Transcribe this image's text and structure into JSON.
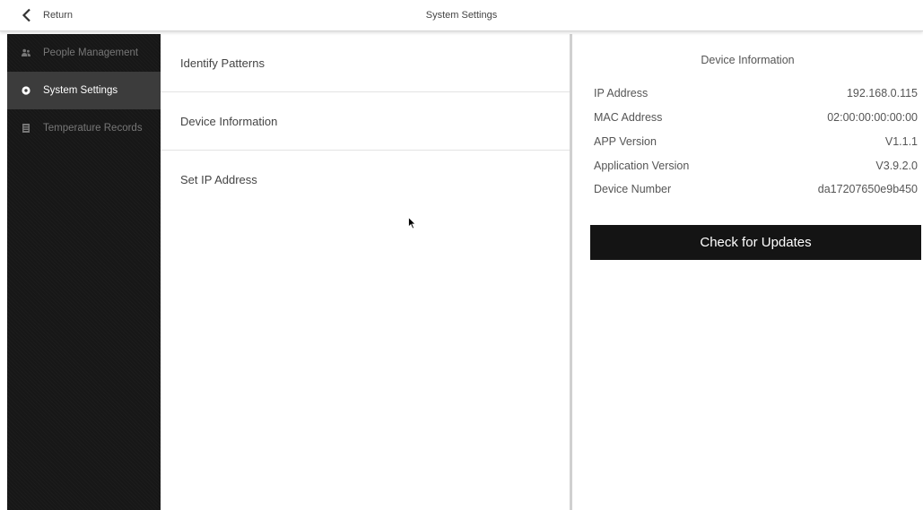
{
  "header": {
    "back_label": "Return",
    "title": "System Settings"
  },
  "sidebar": {
    "items": [
      {
        "label": "People Management",
        "icon": "people-icon",
        "active": false
      },
      {
        "label": "System Settings",
        "icon": "gear-icon",
        "active": true
      },
      {
        "label": "Temperature Records",
        "icon": "records-icon",
        "active": false
      }
    ]
  },
  "menu": {
    "items": [
      {
        "label": "Identify Patterns"
      },
      {
        "label": "Device Information"
      },
      {
        "label": "Set IP Address"
      }
    ]
  },
  "device_info": {
    "title": "Device Information",
    "rows": [
      {
        "label": "IP Address",
        "value": "192.168.0.115"
      },
      {
        "label": "MAC Address",
        "value": "02:00:00:00:00:00"
      },
      {
        "label": "APP Version",
        "value": "V1.1.1"
      },
      {
        "label": "Application Version",
        "value": "V3.9.2.0"
      },
      {
        "label": "Device Number",
        "value": "da17207650e9b450"
      }
    ],
    "update_button": "Check for Updates"
  },
  "colors": {
    "sidebar_bg": "#171717",
    "sidebar_active": "#3c3c3c",
    "button_bg": "#141414"
  }
}
